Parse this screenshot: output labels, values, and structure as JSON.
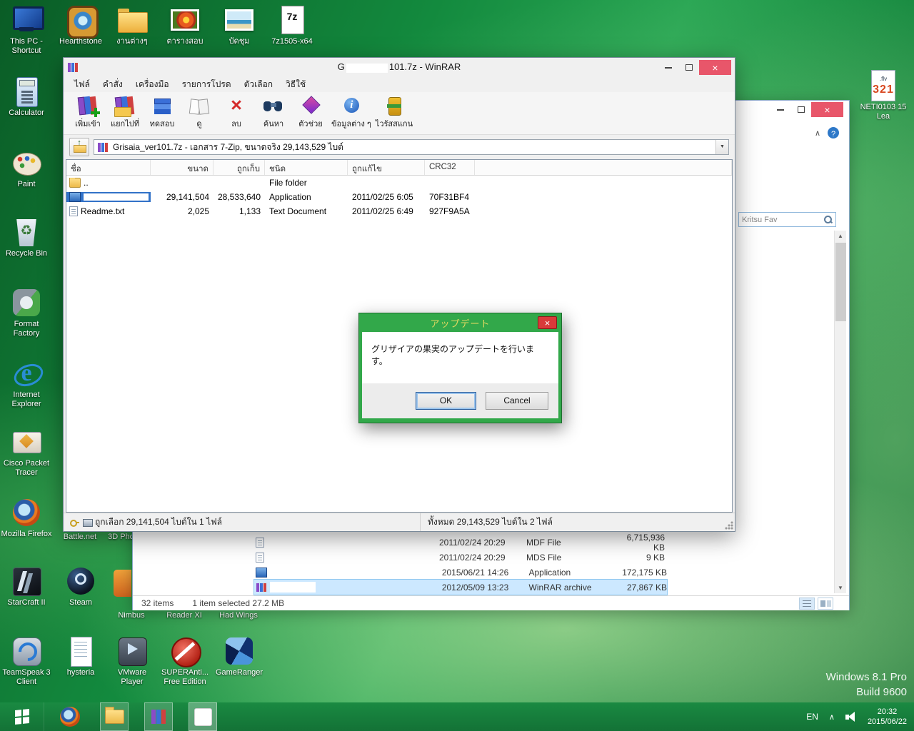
{
  "desktop": {
    "icons": [
      {
        "label": "This PC - Shortcut"
      },
      {
        "label": "Hearthstone"
      },
      {
        "label": "งานต่างๆ"
      },
      {
        "label": "ตารางสอบ"
      },
      {
        "label": "บัดชุม"
      },
      {
        "label": "7z1505-x64"
      },
      {
        "label": "Calculator"
      },
      {
        "label": "Paint"
      },
      {
        "label": "Recycle Bin"
      },
      {
        "label": "Format Factory"
      },
      {
        "label": "Internet Explorer"
      },
      {
        "label": "Cisco Packet Tracer"
      },
      {
        "label": "Mozilla Firefox"
      },
      {
        "label": "StarCraft II"
      },
      {
        "label": "TeamSpeak 3 Client"
      },
      {
        "label": "Steam"
      },
      {
        "label": "hysteria"
      },
      {
        "label": "VMware Player"
      },
      {
        "label": "SUPERAnti... Free Edition"
      },
      {
        "label": "GameRanger"
      },
      {
        "label": "NETI0103 15 Lea"
      }
    ],
    "flv_ext": ".flv",
    "flv_badge": "321",
    "partial_labels": [
      "Battle.net",
      "3D Phot",
      "Nimbus",
      "Reader XI",
      "Had Wings"
    ],
    "watermark_line1": "Windows 8.1 Pro",
    "watermark_line2": "Build 9600"
  },
  "winrar": {
    "title_prefix": "G",
    "title_suffix": "101.7z - WinRAR",
    "menu": [
      "ไฟล์",
      "คำสั่ง",
      "เครื่องมือ",
      "รายการโปรด",
      "ตัวเลือก",
      "วิธีใช้"
    ],
    "toolbar": [
      {
        "label": "เพิ่มเข้า"
      },
      {
        "label": "แยกไปที่"
      },
      {
        "label": "ทดสอบ"
      },
      {
        "label": "ดู"
      },
      {
        "label": "ลบ"
      },
      {
        "label": "ค้นหา"
      },
      {
        "label": "ตัวช่วย"
      },
      {
        "label": "ข้อมูลต่าง ๆ"
      },
      {
        "label": "ไวรัสสแกน"
      }
    ],
    "address": "Grisaia_ver101.7z - เอกสาร 7-Zip, ขนาดจริง 29,143,529 ไบต์",
    "columns": [
      "ชื่อ",
      "ขนาด",
      "ถูกเก็บ",
      "ชนิด",
      "ถูกแก้ไข",
      "CRC32"
    ],
    "rows": [
      {
        "name": "..",
        "size": "",
        "packed": "",
        "type": "File folder",
        "modified": "",
        "crc": "",
        "censored": false,
        "selected": false
      },
      {
        "name": "",
        "size": "29,141,504",
        "packed": "28,533,640",
        "type": "Application",
        "modified": "2011/02/25 6:05",
        "crc": "70F31BF4",
        "censored": true,
        "selected": true
      },
      {
        "name": "Readme.txt",
        "size": "2,025",
        "packed": "1,133",
        "type": "Text Document",
        "modified": "2011/02/25 6:49",
        "crc": "927F9A5A",
        "censored": false,
        "selected": false
      }
    ],
    "status_left": "ถูกเลือก 29,141,504 ไบต์ใน 1 ไฟล์",
    "status_right": "ทั้งหมด 29,143,529 ไบต์ใน 2 ไฟล์"
  },
  "update_dialog": {
    "title": "アップデート",
    "message": "グリザイアの果実のアップデートを行います。",
    "ok": "OK",
    "cancel": "Cancel"
  },
  "explorer": {
    "search_text": "Kritsu Fav",
    "rows": [
      {
        "date": "2011/02/24 20:29",
        "type": "MDF File",
        "size": "6,715,936 KB",
        "censored": true,
        "selected": false
      },
      {
        "date": "2011/02/24 20:29",
        "type": "MDS File",
        "size": "9 KB",
        "censored": true,
        "selected": false
      },
      {
        "date": "2015/06/21 14:26",
        "type": "Application",
        "size": "172,175 KB",
        "censored": true,
        "selected": false
      },
      {
        "date": "2012/05/09 13:23",
        "type": "WinRAR archive",
        "size": "27,867 KB",
        "censored": true,
        "selected": true
      }
    ],
    "status_items": "32 items",
    "status_selected": "1 item selected 27.2 MB"
  },
  "taskbar": {
    "tray_language": "EN",
    "time": "20:32",
    "date": "2015/06/22"
  }
}
